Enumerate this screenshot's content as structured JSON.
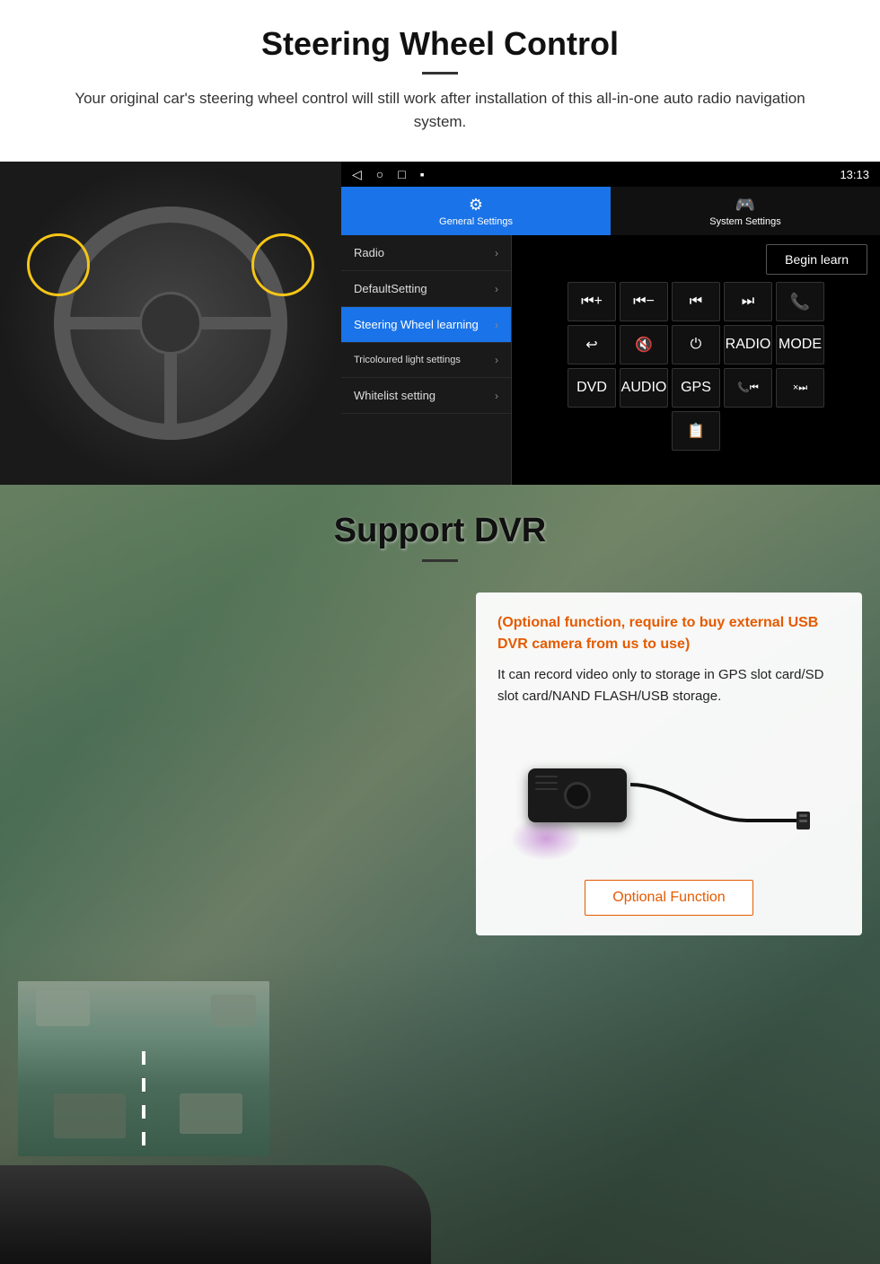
{
  "section1": {
    "title": "Steering Wheel Control",
    "subtitle": "Your original car's steering wheel control will still work after installation of this all-in-one auto radio navigation system.",
    "statusbar": {
      "nav_back": "◁",
      "nav_home": "○",
      "nav_square": "□",
      "nav_menu": "▪",
      "time": "13:13",
      "signal": "▼",
      "wifi": "▼"
    },
    "tabs": {
      "general_settings_icon": "⚙",
      "general_settings_label": "General Settings",
      "system_settings_icon": "🎮",
      "system_settings_label": "System Settings"
    },
    "menu": {
      "items": [
        {
          "label": "Radio",
          "active": false
        },
        {
          "label": "DefaultSetting",
          "active": false
        },
        {
          "label": "Steering Wheel learning",
          "active": true
        },
        {
          "label": "Tricoloured light settings",
          "active": false
        },
        {
          "label": "Whitelist setting",
          "active": false
        }
      ]
    },
    "control_panel": {
      "begin_learn": "Begin learn",
      "buttons_row1": [
        "⏮+",
        "⏮-",
        "⏮|",
        "|⏭",
        "📞"
      ],
      "buttons_row2": [
        "↩",
        "🔇×",
        "⏻",
        "RADIO",
        "MODE"
      ],
      "buttons_row3": [
        "DVD",
        "AUDIO",
        "GPS",
        "📞⏮|",
        "×⏭"
      ],
      "buttons_row4": [
        "📋"
      ]
    }
  },
  "section2": {
    "title": "Support DVR",
    "info_card": {
      "orange_text": "(Optional function, require to buy external USB DVR camera from us to use)",
      "black_text": "It can record video only to storage in GPS slot card/SD slot card/NAND FLASH/USB storage."
    },
    "optional_button_label": "Optional Function"
  }
}
